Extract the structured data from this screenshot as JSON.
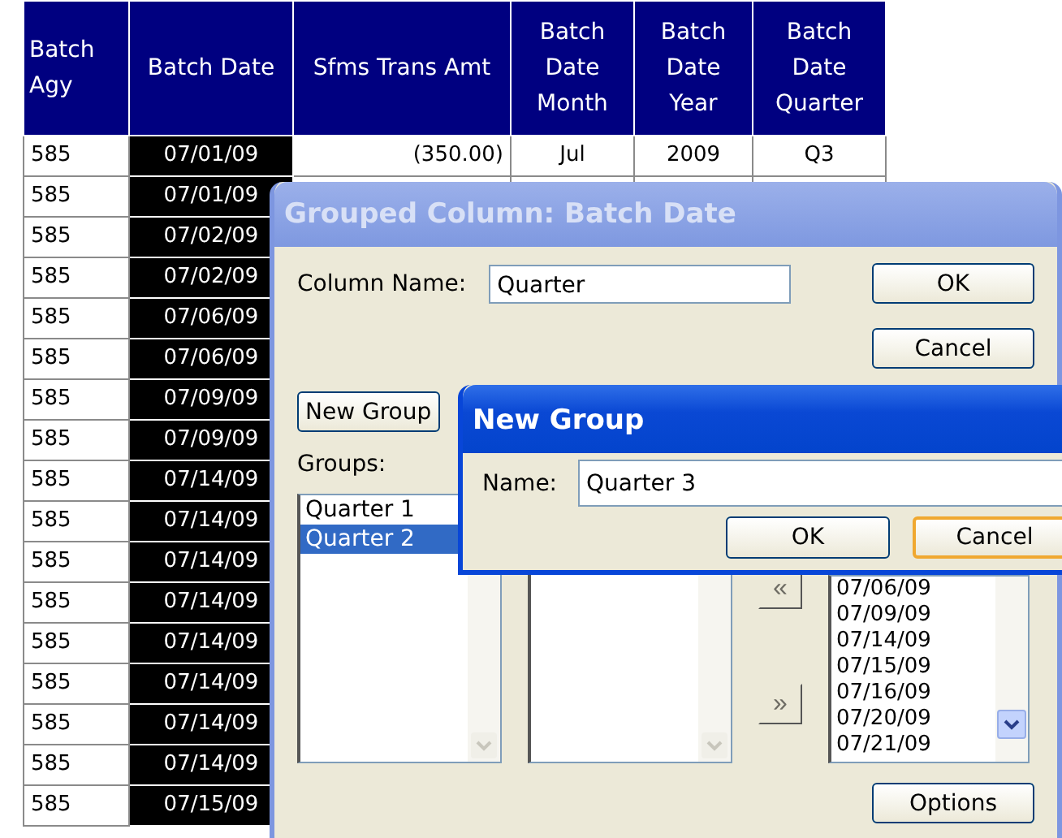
{
  "table": {
    "columns": [
      {
        "label": "Batch Agy",
        "selected": false
      },
      {
        "label": "Batch Date",
        "selected": true
      },
      {
        "label": "Sfms Trans Amt",
        "selected": false
      },
      {
        "label": "Batch Date Month",
        "selected": false
      },
      {
        "label": "Batch Date Year",
        "selected": false
      },
      {
        "label": "Batch Date Quarter",
        "selected": false
      }
    ],
    "rows": [
      [
        "585",
        "07/01/09",
        "(350.00)",
        "Jul",
        "2009",
        "Q3"
      ],
      [
        "585",
        "07/01/09"
      ],
      [
        "585",
        "07/02/09"
      ],
      [
        "585",
        "07/02/09"
      ],
      [
        "585",
        "07/06/09"
      ],
      [
        "585",
        "07/06/09"
      ],
      [
        "585",
        "07/09/09"
      ],
      [
        "585",
        "07/09/09"
      ],
      [
        "585",
        "07/14/09"
      ],
      [
        "585",
        "07/14/09"
      ],
      [
        "585",
        "07/14/09"
      ],
      [
        "585",
        "07/14/09"
      ],
      [
        "585",
        "07/14/09"
      ],
      [
        "585",
        "07/14/09"
      ],
      [
        "585",
        "07/14/09"
      ],
      [
        "585",
        "07/14/09"
      ],
      [
        "585",
        "07/15/09"
      ]
    ]
  },
  "grouped_dialog": {
    "title": "Grouped Column: Batch Date",
    "active": false,
    "column_name_label": "Column Name:",
    "column_name_value": "Quarter",
    "ok_button": "OK",
    "cancel_button": "Cancel",
    "new_group_button": "New Group",
    "groups_label": "Groups:",
    "groups": [
      {
        "label": "Quarter 1",
        "selected": false
      },
      {
        "label": "Quarter 2",
        "selected": true
      }
    ],
    "move_left_button": "«",
    "move_right_button": "»",
    "available_values": [
      "07/06/09",
      "07/09/09",
      "07/14/09",
      "07/15/09",
      "07/16/09",
      "07/20/09",
      "07/21/09"
    ],
    "options_button": "Options"
  },
  "new_group_dialog": {
    "title": "New Group",
    "active": true,
    "name_label": "Name:",
    "name_value": "Quarter 3",
    "buttons": [
      {
        "label": "OK",
        "focused": false
      },
      {
        "label": "Cancel",
        "focused": true
      }
    ]
  }
}
